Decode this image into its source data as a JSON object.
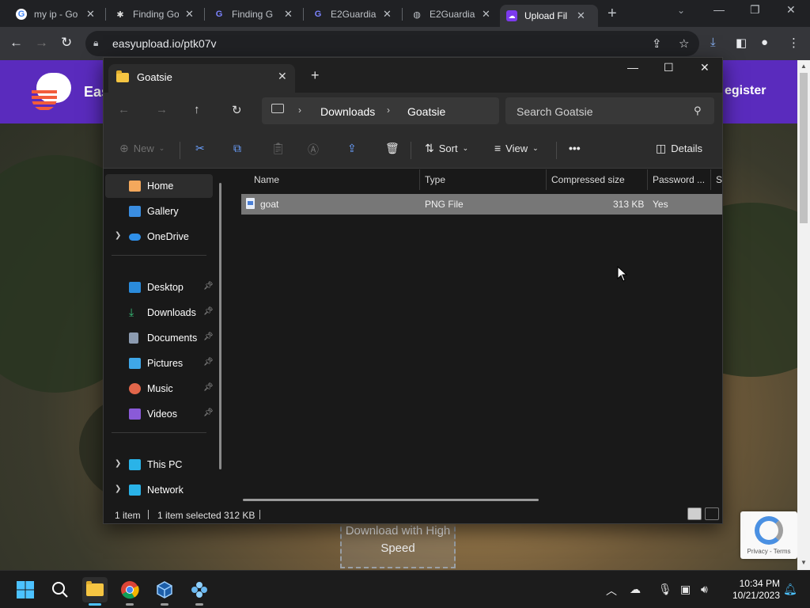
{
  "browser": {
    "tabs": [
      {
        "title": "my ip - Go",
        "icon": "google-icon",
        "active": false
      },
      {
        "title": "Finding Go",
        "icon": "site-icon",
        "active": false
      },
      {
        "title": "Finding G",
        "icon": "e2-icon",
        "active": false
      },
      {
        "title": "E2Guardia",
        "icon": "e2-icon",
        "active": false
      },
      {
        "title": "E2Guardia",
        "icon": "globe-icon",
        "active": false
      },
      {
        "title": "Upload Fil",
        "icon": "easyupload-icon",
        "active": true
      }
    ],
    "url": "easyupload.io/ptk07v"
  },
  "webpage": {
    "brand": "Eas",
    "register": "egister",
    "download_button": [
      "Download with High",
      "Speed"
    ],
    "recaptcha_text": "Privacy - Terms"
  },
  "explorer": {
    "tab_title": "Goatsie",
    "breadcrumb": [
      "Downloads",
      "Goatsie"
    ],
    "search_placeholder": "Search Goatsie",
    "commands": {
      "new": "New",
      "sort": "Sort",
      "view": "View",
      "more": "•••",
      "details": "Details"
    },
    "nav": {
      "home": "Home",
      "gallery": "Gallery",
      "onedrive": "OneDrive",
      "desktop": "Desktop",
      "downloads": "Downloads",
      "documents": "Documents",
      "pictures": "Pictures",
      "music": "Music",
      "videos": "Videos",
      "thispc": "This PC",
      "network": "Network"
    },
    "columns": [
      "Name",
      "Type",
      "Compressed size",
      "Password ...",
      "Si"
    ],
    "files": [
      {
        "name": "goat",
        "type": "PNG File",
        "compressed_size": "313 KB",
        "password": "Yes"
      }
    ],
    "status": {
      "count": "1 item",
      "selected": "1 item selected",
      "size": "312 KB"
    }
  },
  "taskbar": {
    "time": "10:34 PM",
    "date": "10/21/2023"
  },
  "colors": {
    "site_header": "#5a2bbd",
    "selection": "#777777",
    "accent": "#4cc2ff"
  }
}
